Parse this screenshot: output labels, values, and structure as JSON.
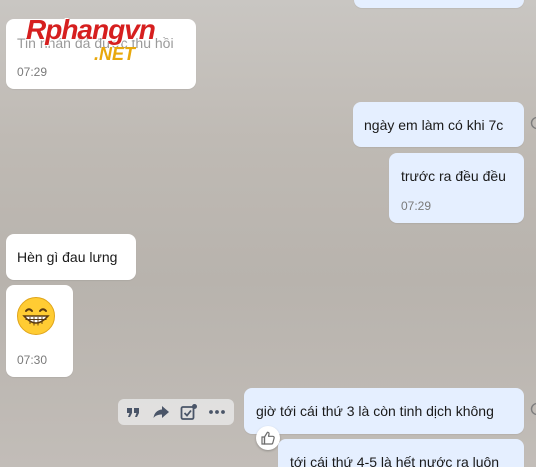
{
  "watermark": {
    "brand": "Rphangvn",
    "suffix": ".NET"
  },
  "messages": {
    "m1": {
      "text": "Tin nhắn đã được thu hồi",
      "time": "07:29"
    },
    "m2": {
      "text": "ngày em làm có khi 7c"
    },
    "m3": {
      "text": "trước ra đều đều",
      "time": "07:29"
    },
    "m4": {
      "text": "Hèn gì đau lưng"
    },
    "m5": {
      "emoji": "😁",
      "time": "07:30"
    },
    "m6": {
      "text": "giờ tới cái thứ 3 là còn tinh dịch không"
    },
    "m7": {
      "text": "tới cái thứ 4-5 là hết nước ra luôn"
    }
  },
  "icons": {
    "quote": "quote-icon",
    "forward": "forward-icon",
    "task": "task-icon",
    "more": "more-icon",
    "like": "thumbs-up-icon"
  },
  "colors": {
    "incoming_bubble": "#ffffff",
    "outgoing_bubble": "#e5efff",
    "timestamp": "#7a7a7a"
  }
}
